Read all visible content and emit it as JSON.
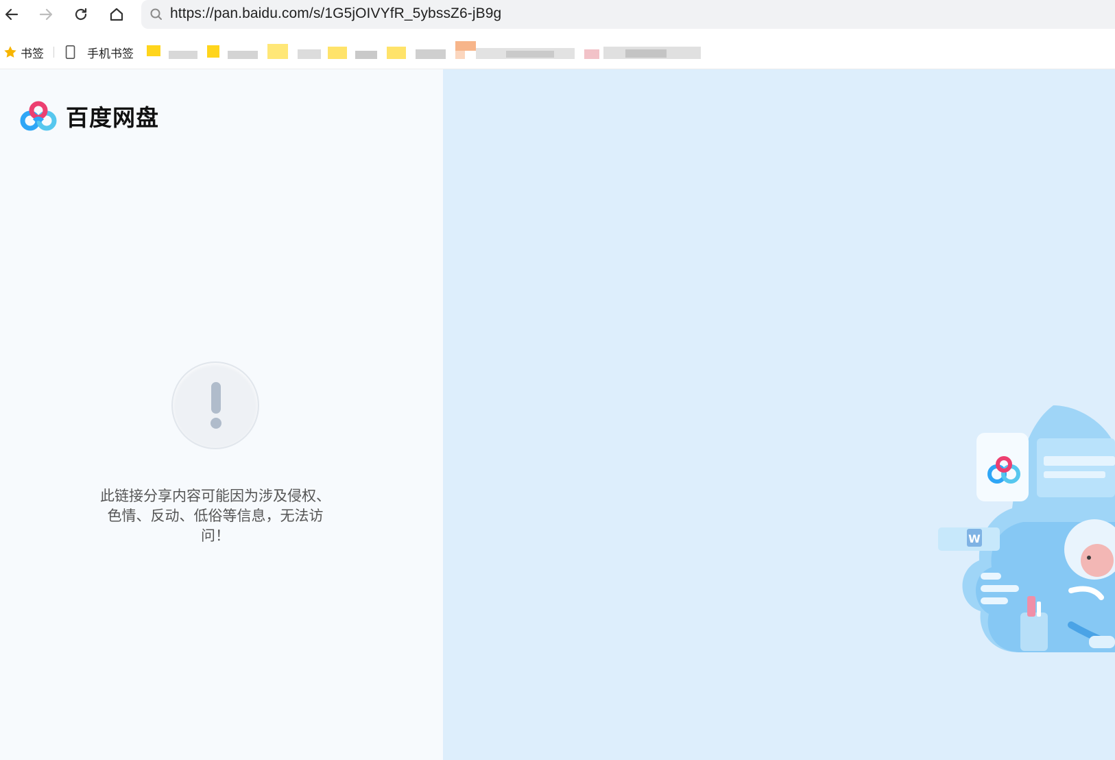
{
  "browser": {
    "url": "https://pan.baidu.com/s/1G5jOIVYfR_5ybssZ6-jB9g",
    "nav": {
      "back": "arrow-left-icon",
      "forward": "arrow-right-icon",
      "reload": "reload-icon",
      "home": "home-icon"
    }
  },
  "bookmarks": {
    "bookmarks_label": "书签",
    "mobile_label": "手机书签"
  },
  "page": {
    "brand": "百度网盘",
    "message": "此链接分享内容可能因为涉及侵权、色情、反动、低俗等信息，无法访问！",
    "illustration_badge": "W"
  },
  "colors": {
    "left_bg": "#f7fafd",
    "right_bg": "#ddeefc",
    "warning_icon": "#b0bccb"
  }
}
